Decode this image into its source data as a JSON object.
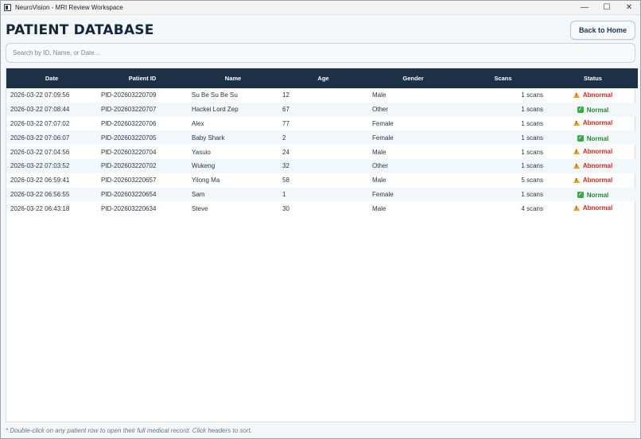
{
  "window": {
    "title": "NeuroVision - MRI Review Workspace",
    "controls": {
      "minimize": "—",
      "maximize": "☐",
      "close": "✕"
    }
  },
  "header": {
    "title": "PATIENT DATABASE",
    "back_label": "Back to Home"
  },
  "search": {
    "placeholder": "Search by ID, Name, or Date..."
  },
  "table": {
    "columns": [
      "Date",
      "Patient ID",
      "Name",
      "Age",
      "Gender",
      "Scans",
      "Status"
    ],
    "rows": [
      {
        "date": "2026-03-22 07:09:56",
        "pid": "PID-202603220709",
        "name": "Su Be Su Be Su",
        "age": "12",
        "gender": "Male",
        "scans": "1 scans",
        "status": "Abnormal"
      },
      {
        "date": "2026-03-22 07:08:44",
        "pid": "PID-202603220707",
        "name": "Hackei Lord Zep",
        "age": "67",
        "gender": "Other",
        "scans": "1 scans",
        "status": "Normal"
      },
      {
        "date": "2026-03-22 07:07:02",
        "pid": "PID-202603220706",
        "name": "Alex",
        "age": "77",
        "gender": "Female",
        "scans": "1 scans",
        "status": "Abnormal"
      },
      {
        "date": "2026-03-22 07:06:07",
        "pid": "PID-202603220705",
        "name": "Baby Shark",
        "age": "2",
        "gender": "Female",
        "scans": "1 scans",
        "status": "Normal"
      },
      {
        "date": "2026-03-22 07:04:56",
        "pid": "PID-202603220704",
        "name": "Yasuio",
        "age": "24",
        "gender": "Male",
        "scans": "1 scans",
        "status": "Abnormal"
      },
      {
        "date": "2026-03-22 07:03:52",
        "pid": "PID-202603220702",
        "name": "Wukeng",
        "age": "32",
        "gender": "Other",
        "scans": "1 scans",
        "status": "Abnormal"
      },
      {
        "date": "2026-03-22 06:59:41",
        "pid": "PID-202603220657",
        "name": "Yilong Ma",
        "age": "58",
        "gender": "Male",
        "scans": "5 scans",
        "status": "Abnormal"
      },
      {
        "date": "2026-03-22 06:56:55",
        "pid": "PID-202603220654",
        "name": "Sam",
        "age": "1",
        "gender": "Female",
        "scans": "1 scans",
        "status": "Normal"
      },
      {
        "date": "2026-03-22 06:43:18",
        "pid": "PID-202603220634",
        "name": "Steve",
        "age": "30",
        "gender": "Male",
        "scans": "4 scans",
        "status": "Abnormal"
      }
    ]
  },
  "status_styles": {
    "Abnormal": {
      "icon": "warning-icon",
      "color": "#d9261c"
    },
    "Normal": {
      "icon": "check-icon",
      "color": "#238a2e"
    }
  },
  "colors": {
    "header_bg": "#1c3046",
    "title": "#14263b"
  },
  "footer": {
    "note": "* Double-click on any patient row to open their full medical record. Click headers to sort."
  }
}
